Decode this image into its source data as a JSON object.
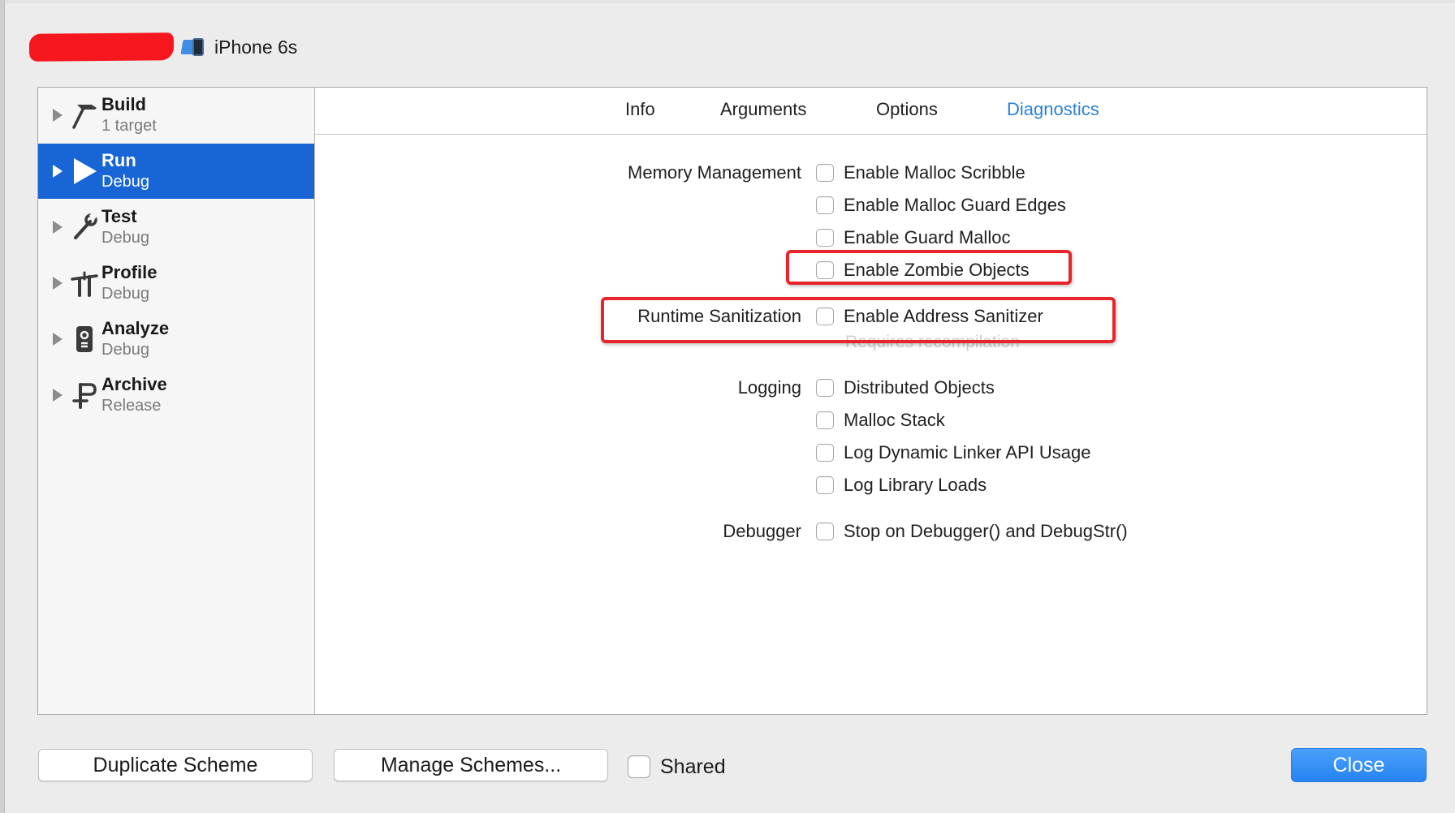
{
  "toolbar": {
    "device_name": "iPhone 6s"
  },
  "sidebar": {
    "items": [
      {
        "title": "Build",
        "subtitle": "1 target",
        "icon": "hammer-icon"
      },
      {
        "title": "Run",
        "subtitle": "Debug",
        "icon": "play-icon",
        "selected": true
      },
      {
        "title": "Test",
        "subtitle": "Debug",
        "icon": "wrench-icon"
      },
      {
        "title": "Profile",
        "subtitle": "Debug",
        "icon": "instruments-icon"
      },
      {
        "title": "Analyze",
        "subtitle": "Debug",
        "icon": "analyze-icon"
      },
      {
        "title": "Archive",
        "subtitle": "Release",
        "icon": "archive-icon"
      }
    ]
  },
  "tabs": [
    {
      "label": "Info"
    },
    {
      "label": "Arguments"
    },
    {
      "label": "Options"
    },
    {
      "label": "Diagnostics",
      "active": true
    }
  ],
  "diagnostics": {
    "memory_management": {
      "label": "Memory Management",
      "options": [
        {
          "label": "Enable Malloc Scribble",
          "checked": false
        },
        {
          "label": "Enable Malloc Guard Edges",
          "checked": false
        },
        {
          "label": "Enable Guard Malloc",
          "checked": false
        },
        {
          "label": "Enable Zombie Objects",
          "checked": false
        }
      ]
    },
    "runtime_sanitization": {
      "label": "Runtime Sanitization",
      "options": [
        {
          "label": "Enable Address Sanitizer",
          "checked": false
        }
      ],
      "note": "Requires recompilation"
    },
    "logging": {
      "label": "Logging",
      "options": [
        {
          "label": "Distributed Objects",
          "checked": false
        },
        {
          "label": "Malloc Stack",
          "checked": false
        },
        {
          "label": "Log Dynamic Linker API Usage",
          "checked": false
        },
        {
          "label": "Log Library Loads",
          "checked": false
        }
      ]
    },
    "debugger": {
      "label": "Debugger",
      "options": [
        {
          "label": "Stop on Debugger() and DebugStr()",
          "checked": false
        }
      ]
    }
  },
  "footer": {
    "duplicate_label": "Duplicate Scheme",
    "manage_label": "Manage Schemes...",
    "shared_label": "Shared",
    "shared_checked": false,
    "close_label": "Close"
  },
  "colors": {
    "selection": "#1866d6",
    "active_tab": "#2a7fd8",
    "annotation": "#e8252a",
    "close_button": "#2683f2"
  }
}
